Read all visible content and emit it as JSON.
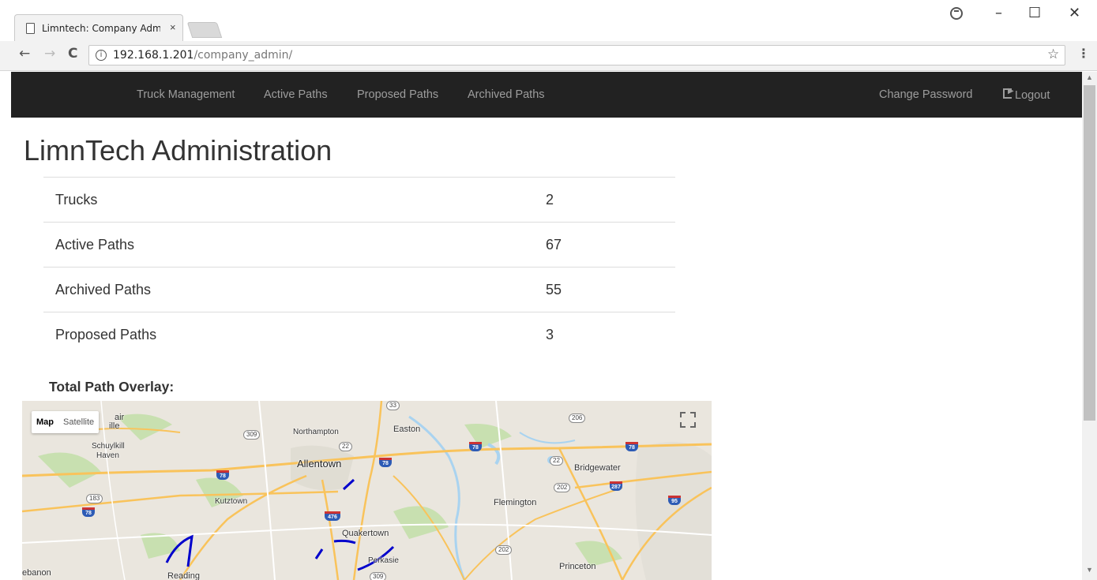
{
  "browser": {
    "tab_title": "Limntech: Company Adm",
    "tab_close": "×",
    "url_host": "192.168.1.201",
    "url_path": "/company_admin/",
    "back": "←",
    "forward": "→",
    "reload": "C",
    "info": "i",
    "star": "☆",
    "menu": "⋮",
    "minimize": "–",
    "maximize": "☐",
    "close": "✕"
  },
  "navbar": {
    "items": [
      {
        "label": "Truck Management"
      },
      {
        "label": "Active Paths"
      },
      {
        "label": "Proposed Paths"
      },
      {
        "label": "Archived Paths"
      }
    ],
    "right": [
      {
        "label": "Change Password"
      },
      {
        "label": "Logout",
        "icon": "logout-icon"
      }
    ]
  },
  "page": {
    "title": "LimnTech Administration",
    "stats": [
      {
        "label": "Trucks",
        "value": "2"
      },
      {
        "label": "Active Paths",
        "value": "67"
      },
      {
        "label": "Archived Paths",
        "value": "55"
      },
      {
        "label": "Proposed Paths",
        "value": "3"
      }
    ],
    "overlay_label": "Total Path Overlay:"
  },
  "map": {
    "type_buttons": {
      "map": "Map",
      "satellite": "Satellite"
    },
    "places": {
      "northampton": "Northampton",
      "easton": "Easton",
      "allentown": "Allentown",
      "bridgewater": "Bridgewater",
      "schuylkill": "Schuylkill",
      "haven": "Haven",
      "kutztown": "Kutztown",
      "flemington": "Flemington",
      "quakertown": "Quakertown",
      "perkasie": "Perkasie",
      "princeton": "Princeton",
      "reading": "Reading",
      "lebanon": "ebanon",
      "ille": "ille",
      "air": "air"
    },
    "shields": {
      "s33": "33",
      "s206": "206",
      "s309a": "309",
      "s22a": "22",
      "s22b": "22",
      "s202a": "202",
      "s202b": "202",
      "s183": "183",
      "s309b": "309",
      "i78a": "78",
      "i78b": "78",
      "i78c": "78",
      "i78d": "78",
      "i78e": "78",
      "i287": "287",
      "i95": "95",
      "i476": "476"
    },
    "colors": {
      "land": "#eae6de",
      "road": "#f9c35b",
      "water": "#a9d3f0",
      "park": "#c8e0b0",
      "path": "#0000cc"
    }
  }
}
